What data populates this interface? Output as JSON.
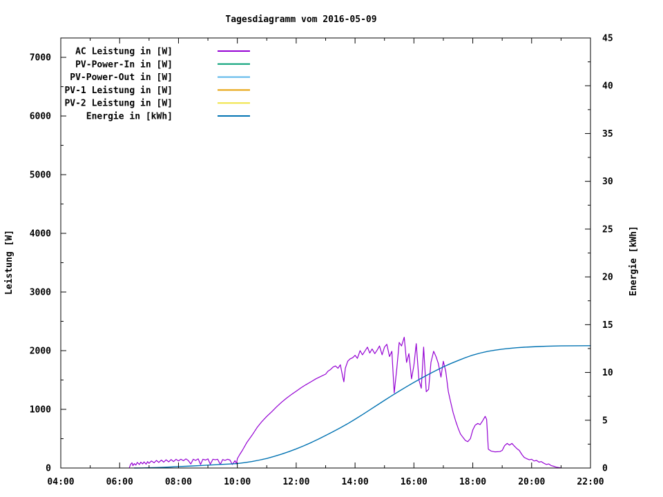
{
  "title": "Tagesdiagramm vom 2016-05-09",
  "colors": {
    "background": "#ffffff",
    "axis": "#000000",
    "ac": "#9400d3",
    "pv_in": "#009e73",
    "pv_out": "#56b4e9",
    "pv1": "#e69f00",
    "pv2": "#f0e442",
    "energie": "#0072b2"
  },
  "chart_data": {
    "type": "line",
    "title": "Tagesdiagramm vom 2016-05-09",
    "grid": false,
    "legend_position": "top-left-inside",
    "x_axis": {
      "label": "",
      "unit": "time",
      "range_hours": [
        4,
        22
      ],
      "major_tick_hours": [
        4,
        6,
        8,
        10,
        12,
        14,
        16,
        18,
        20,
        22
      ],
      "tick_labels": [
        "04:00",
        "06:00",
        "08:00",
        "10:00",
        "12:00",
        "14:00",
        "16:00",
        "18:00",
        "20:00",
        "22:00"
      ],
      "minor_step_hours": 1
    },
    "y_axis": {
      "label": "Leistung [W]",
      "range": [
        0,
        7330
      ],
      "major_ticks": [
        0,
        1000,
        2000,
        3000,
        4000,
        5000,
        6000,
        7000
      ],
      "tick_labels": [
        "0",
        "1000",
        "2000",
        "3000",
        "4000",
        "5000",
        "6000",
        "7000"
      ],
      "minor_step": 500
    },
    "y2_axis": {
      "label": "Energie [kWh]",
      "range": [
        0,
        45
      ],
      "major_ticks": [
        0,
        5,
        10,
        15,
        20,
        25,
        30,
        35,
        40,
        45
      ],
      "tick_labels": [
        "0",
        "5",
        "10",
        "15",
        "20",
        "25",
        "30",
        "35",
        "40",
        "45"
      ],
      "minor_step": 2.5
    },
    "legend": [
      {
        "label": "AC Leistung in [W]",
        "color": "#9400d3"
      },
      {
        "label": "PV-Power-In in [W]",
        "color": "#009e73"
      },
      {
        "label": "PV-Power-Out in [W]",
        "color": "#56b4e9"
      },
      {
        "label": "PV-1 Leistung in [W]",
        "color": "#e69f00"
      },
      {
        "label": "PV-2 Leistung in [W]",
        "color": "#f0e442"
      },
      {
        "label": "Energie in [kWh]",
        "color": "#0072b2"
      }
    ],
    "series": [
      {
        "name": "AC Leistung in [W]",
        "axis": "y1",
        "color": "#9400d3",
        "width": 1.2,
        "points": [
          [
            6.33,
            5
          ],
          [
            6.37,
            60
          ],
          [
            6.42,
            90
          ],
          [
            6.45,
            40
          ],
          [
            6.5,
            75
          ],
          [
            6.55,
            50
          ],
          [
            6.6,
            95
          ],
          [
            6.67,
            60
          ],
          [
            6.72,
            100
          ],
          [
            6.78,
            70
          ],
          [
            6.83,
            105
          ],
          [
            6.9,
            65
          ],
          [
            6.95,
            110
          ],
          [
            7.0,
            80
          ],
          [
            7.08,
            120
          ],
          [
            7.17,
            90
          ],
          [
            7.25,
            130
          ],
          [
            7.33,
            95
          ],
          [
            7.42,
            135
          ],
          [
            7.5,
            100
          ],
          [
            7.58,
            140
          ],
          [
            7.67,
            105
          ],
          [
            7.75,
            145
          ],
          [
            7.83,
            110
          ],
          [
            7.92,
            150
          ],
          [
            8.0,
            120
          ],
          [
            8.08,
            150
          ],
          [
            8.17,
            125
          ],
          [
            8.25,
            155
          ],
          [
            8.33,
            130
          ],
          [
            8.42,
            70
          ],
          [
            8.5,
            150
          ],
          [
            8.58,
            130
          ],
          [
            8.67,
            155
          ],
          [
            8.75,
            60
          ],
          [
            8.83,
            150
          ],
          [
            8.92,
            135
          ],
          [
            9.0,
            155
          ],
          [
            9.08,
            65
          ],
          [
            9.17,
            150
          ],
          [
            9.25,
            140
          ],
          [
            9.33,
            150
          ],
          [
            9.42,
            60
          ],
          [
            9.5,
            145
          ],
          [
            9.58,
            130
          ],
          [
            9.67,
            150
          ],
          [
            9.75,
            135
          ],
          [
            9.83,
            60
          ],
          [
            9.92,
            125
          ],
          [
            9.97,
            70
          ],
          [
            10.0,
            160
          ],
          [
            10.08,
            230
          ],
          [
            10.17,
            300
          ],
          [
            10.25,
            370
          ],
          [
            10.33,
            440
          ],
          [
            10.5,
            560
          ],
          [
            10.67,
            690
          ],
          [
            10.83,
            790
          ],
          [
            11.0,
            880
          ],
          [
            11.17,
            960
          ],
          [
            11.33,
            1040
          ],
          [
            11.5,
            1120
          ],
          [
            11.67,
            1190
          ],
          [
            11.83,
            1250
          ],
          [
            12.0,
            1310
          ],
          [
            12.17,
            1370
          ],
          [
            12.33,
            1420
          ],
          [
            12.5,
            1470
          ],
          [
            12.67,
            1520
          ],
          [
            12.83,
            1560
          ],
          [
            13.0,
            1600
          ],
          [
            13.08,
            1650
          ],
          [
            13.17,
            1680
          ],
          [
            13.25,
            1720
          ],
          [
            13.33,
            1740
          ],
          [
            13.42,
            1700
          ],
          [
            13.5,
            1760
          ],
          [
            13.58,
            1560
          ],
          [
            13.62,
            1470
          ],
          [
            13.67,
            1700
          ],
          [
            13.75,
            1820
          ],
          [
            13.83,
            1860
          ],
          [
            13.92,
            1880
          ],
          [
            14.0,
            1920
          ],
          [
            14.08,
            1870
          ],
          [
            14.17,
            2000
          ],
          [
            14.25,
            1930
          ],
          [
            14.33,
            1990
          ],
          [
            14.42,
            2060
          ],
          [
            14.5,
            1960
          ],
          [
            14.58,
            2030
          ],
          [
            14.67,
            1950
          ],
          [
            14.75,
            2010
          ],
          [
            14.83,
            2080
          ],
          [
            14.92,
            1930
          ],
          [
            15.0,
            2060
          ],
          [
            15.08,
            2110
          ],
          [
            15.17,
            1900
          ],
          [
            15.25,
            1990
          ],
          [
            15.33,
            1280
          ],
          [
            15.42,
            1700
          ],
          [
            15.5,
            2140
          ],
          [
            15.58,
            2080
          ],
          [
            15.67,
            2230
          ],
          [
            15.75,
            1800
          ],
          [
            15.83,
            1950
          ],
          [
            15.92,
            1520
          ],
          [
            16.0,
            1750
          ],
          [
            16.08,
            2120
          ],
          [
            16.17,
            1500
          ],
          [
            16.25,
            1360
          ],
          [
            16.33,
            2060
          ],
          [
            16.42,
            1300
          ],
          [
            16.5,
            1340
          ],
          [
            16.58,
            1800
          ],
          [
            16.67,
            1990
          ],
          [
            16.75,
            1900
          ],
          [
            16.83,
            1780
          ],
          [
            16.92,
            1550
          ],
          [
            17.0,
            1820
          ],
          [
            17.08,
            1650
          ],
          [
            17.17,
            1300
          ],
          [
            17.25,
            1120
          ],
          [
            17.33,
            950
          ],
          [
            17.42,
            800
          ],
          [
            17.5,
            680
          ],
          [
            17.58,
            580
          ],
          [
            17.67,
            520
          ],
          [
            17.75,
            470
          ],
          [
            17.83,
            450
          ],
          [
            17.92,
            500
          ],
          [
            18.0,
            650
          ],
          [
            18.08,
            730
          ],
          [
            18.17,
            760
          ],
          [
            18.25,
            740
          ],
          [
            18.33,
            800
          ],
          [
            18.42,
            880
          ],
          [
            18.47,
            830
          ],
          [
            18.53,
            320
          ],
          [
            18.62,
            290
          ],
          [
            18.75,
            275
          ],
          [
            18.92,
            280
          ],
          [
            19.0,
            300
          ],
          [
            19.08,
            380
          ],
          [
            19.17,
            420
          ],
          [
            19.25,
            390
          ],
          [
            19.33,
            420
          ],
          [
            19.42,
            370
          ],
          [
            19.5,
            330
          ],
          [
            19.58,
            300
          ],
          [
            19.67,
            230
          ],
          [
            19.75,
            180
          ],
          [
            19.83,
            160
          ],
          [
            19.92,
            140
          ],
          [
            20.0,
            150
          ],
          [
            20.08,
            120
          ],
          [
            20.17,
            130
          ],
          [
            20.25,
            100
          ],
          [
            20.33,
            110
          ],
          [
            20.42,
            80
          ],
          [
            20.5,
            60
          ],
          [
            20.58,
            70
          ],
          [
            20.67,
            40
          ],
          [
            20.75,
            30
          ],
          [
            20.83,
            15
          ],
          [
            20.92,
            8
          ],
          [
            21.0,
            2
          ]
        ]
      },
      {
        "name": "PV-Power-In in [W]",
        "axis": "y1",
        "color": "#009e73",
        "width": 1.2,
        "points": []
      },
      {
        "name": "PV-Power-Out in [W]",
        "axis": "y1",
        "color": "#56b4e9",
        "width": 1.2,
        "points": []
      },
      {
        "name": "PV-1 Leistung in [W]",
        "axis": "y1",
        "color": "#e69f00",
        "width": 1.2,
        "points": []
      },
      {
        "name": "PV-2 Leistung in [W]",
        "axis": "y1",
        "color": "#f0e442",
        "width": 1.2,
        "points": []
      },
      {
        "name": "Energie in [kWh]",
        "axis": "y2",
        "color": "#0072b2",
        "width": 1.4,
        "points": [
          [
            6.5,
            0
          ],
          [
            6.75,
            0.01
          ],
          [
            7.0,
            0.03
          ],
          [
            7.25,
            0.05
          ],
          [
            7.5,
            0.08
          ],
          [
            7.75,
            0.11
          ],
          [
            8.0,
            0.15
          ],
          [
            8.25,
            0.18
          ],
          [
            8.5,
            0.22
          ],
          [
            8.75,
            0.26
          ],
          [
            9.0,
            0.3
          ],
          [
            9.25,
            0.34
          ],
          [
            9.5,
            0.38
          ],
          [
            9.75,
            0.42
          ],
          [
            10.0,
            0.46
          ],
          [
            10.25,
            0.56
          ],
          [
            10.5,
            0.68
          ],
          [
            10.75,
            0.83
          ],
          [
            11.0,
            1.0
          ],
          [
            11.25,
            1.21
          ],
          [
            11.5,
            1.45
          ],
          [
            11.75,
            1.71
          ],
          [
            12.0,
            2.0
          ],
          [
            12.25,
            2.31
          ],
          [
            12.5,
            2.65
          ],
          [
            12.75,
            3.01
          ],
          [
            13.0,
            3.4
          ],
          [
            13.25,
            3.8
          ],
          [
            13.5,
            4.21
          ],
          [
            13.75,
            4.64
          ],
          [
            14.0,
            5.1
          ],
          [
            14.25,
            5.58
          ],
          [
            14.5,
            6.08
          ],
          [
            14.75,
            6.58
          ],
          [
            15.0,
            7.08
          ],
          [
            15.25,
            7.57
          ],
          [
            15.5,
            8.05
          ],
          [
            15.75,
            8.51
          ],
          [
            16.0,
            8.96
          ],
          [
            16.25,
            9.39
          ],
          [
            16.5,
            9.8
          ],
          [
            16.75,
            10.2
          ],
          [
            17.0,
            10.58
          ],
          [
            17.25,
            10.93
          ],
          [
            17.5,
            11.25
          ],
          [
            17.75,
            11.55
          ],
          [
            18.0,
            11.82
          ],
          [
            18.25,
            12.03
          ],
          [
            18.5,
            12.2
          ],
          [
            18.75,
            12.33
          ],
          [
            19.0,
            12.44
          ],
          [
            19.25,
            12.52
          ],
          [
            19.5,
            12.59
          ],
          [
            19.75,
            12.64
          ],
          [
            20.0,
            12.68
          ],
          [
            20.25,
            12.71
          ],
          [
            20.5,
            12.74
          ],
          [
            20.75,
            12.76
          ],
          [
            21.0,
            12.78
          ],
          [
            21.5,
            12.79
          ],
          [
            22.0,
            12.8
          ]
        ]
      }
    ]
  }
}
